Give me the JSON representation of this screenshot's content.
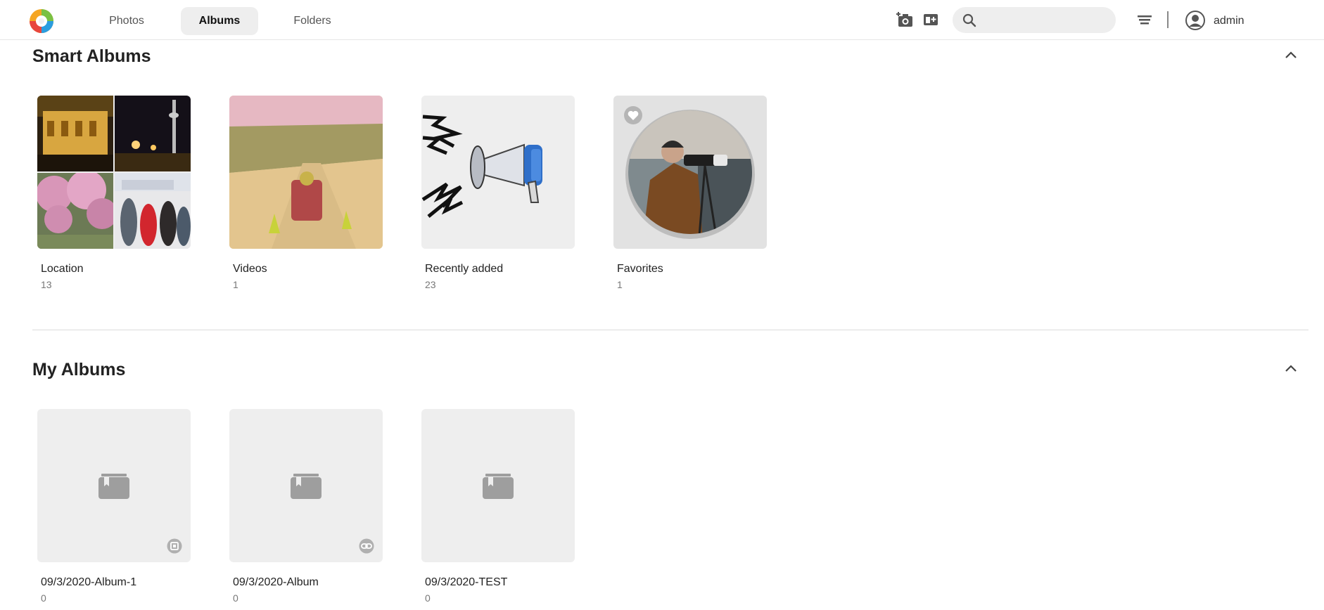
{
  "header": {
    "logo": "app-logo",
    "tabs": [
      {
        "label": "Photos",
        "active": false
      },
      {
        "label": "Albums",
        "active": true
      },
      {
        "label": "Folders",
        "active": false
      }
    ],
    "search": {
      "placeholder": "",
      "value": ""
    },
    "icons": [
      "add-photo-icon",
      "add-album-icon",
      "search-icon",
      "sort-icon",
      "user-icon"
    ],
    "user": "admin"
  },
  "smart_albums": {
    "title": "Smart Albums",
    "items": [
      {
        "name": "Location",
        "count": "13"
      },
      {
        "name": "Videos",
        "count": "1"
      },
      {
        "name": "Recently added",
        "count": "23"
      },
      {
        "name": "Favorites",
        "count": "1"
      }
    ]
  },
  "my_albums": {
    "title": "My Albums",
    "items": [
      {
        "name": "09/3/2020-Album-1",
        "count": "0",
        "badge": "shared-icon"
      },
      {
        "name": "09/3/2020-Album",
        "count": "0",
        "badge": "link-icon"
      },
      {
        "name": "09/3/2020-TEST",
        "count": "0",
        "badge": ""
      }
    ]
  },
  "colors": {
    "accent_tab_bg": "#eeeeee",
    "placeholder_bg": "#eeeeee",
    "text": "#222222"
  }
}
